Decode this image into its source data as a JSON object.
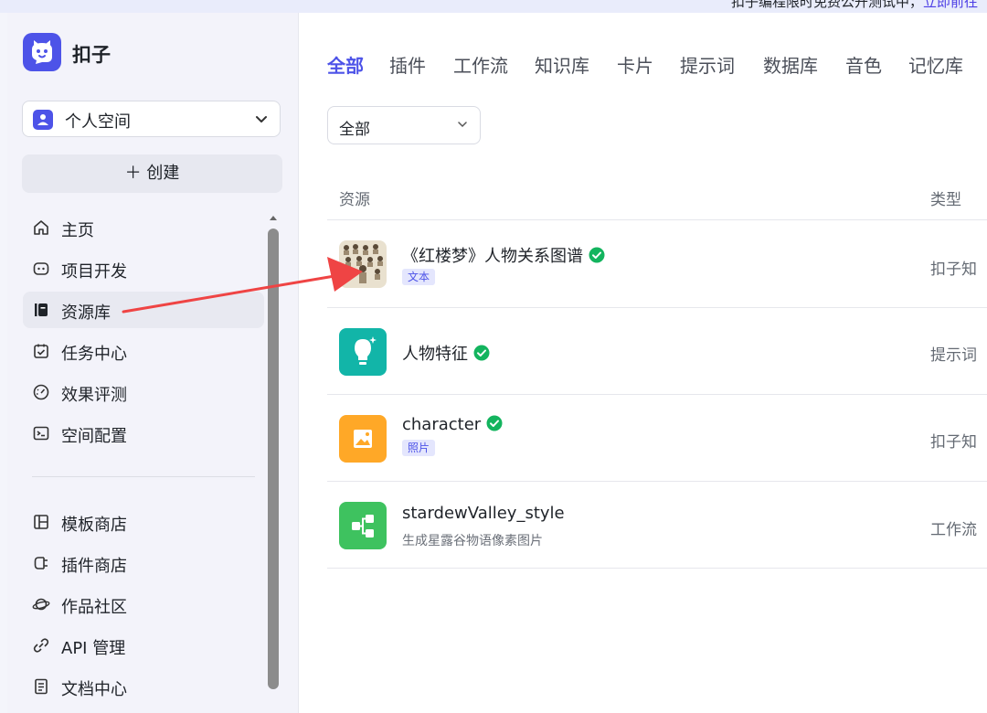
{
  "banner": {
    "text": "扣子编程限时免费公开测试中，",
    "link": "立即前往"
  },
  "app": {
    "name": "扣子"
  },
  "space": {
    "name": "个人空间"
  },
  "create": {
    "label": "创建"
  },
  "nav": {
    "items": [
      {
        "label": "主页",
        "icon": "home-icon"
      },
      {
        "label": "项目开发",
        "icon": "project-icon"
      },
      {
        "label": "资源库",
        "icon": "library-icon",
        "active": true
      },
      {
        "label": "任务中心",
        "icon": "task-icon"
      },
      {
        "label": "效果评测",
        "icon": "gauge-icon"
      },
      {
        "label": "空间配置",
        "icon": "terminal-icon"
      }
    ],
    "bottom_items": [
      {
        "label": "模板商店",
        "icon": "template-icon"
      },
      {
        "label": "插件商店",
        "icon": "plugin-icon"
      },
      {
        "label": "作品社区",
        "icon": "planet-icon"
      },
      {
        "label": "API 管理",
        "icon": "api-icon"
      },
      {
        "label": "文档中心",
        "icon": "document-icon"
      }
    ]
  },
  "tabs": [
    "全部",
    "插件",
    "工作流",
    "知识库",
    "卡片",
    "提示词",
    "数据库",
    "音色",
    "记忆库"
  ],
  "active_tab": "全部",
  "filter": {
    "value": "全部"
  },
  "table": {
    "headers": {
      "resource": "资源",
      "type": "类型"
    },
    "rows": [
      {
        "title": "《红楼梦》人物关系图谱",
        "verified": true,
        "tag": "文本",
        "type": "扣子知",
        "thumb": "sketch-image"
      },
      {
        "title": "人物特征",
        "verified": true,
        "type": "提示词",
        "thumb": "bulb-icon"
      },
      {
        "title": "character",
        "verified": true,
        "tag": "照片",
        "type": "扣子知",
        "thumb": "image-icon"
      },
      {
        "title": "stardewValley_style",
        "subtitle": "生成星露谷物语像素图片",
        "type": "工作流",
        "thumb": "workflow-icon"
      }
    ]
  },
  "colors": {
    "accent": "#4d53e8",
    "verified": "#13b45e",
    "annotation_arrow": "#ef4444"
  }
}
